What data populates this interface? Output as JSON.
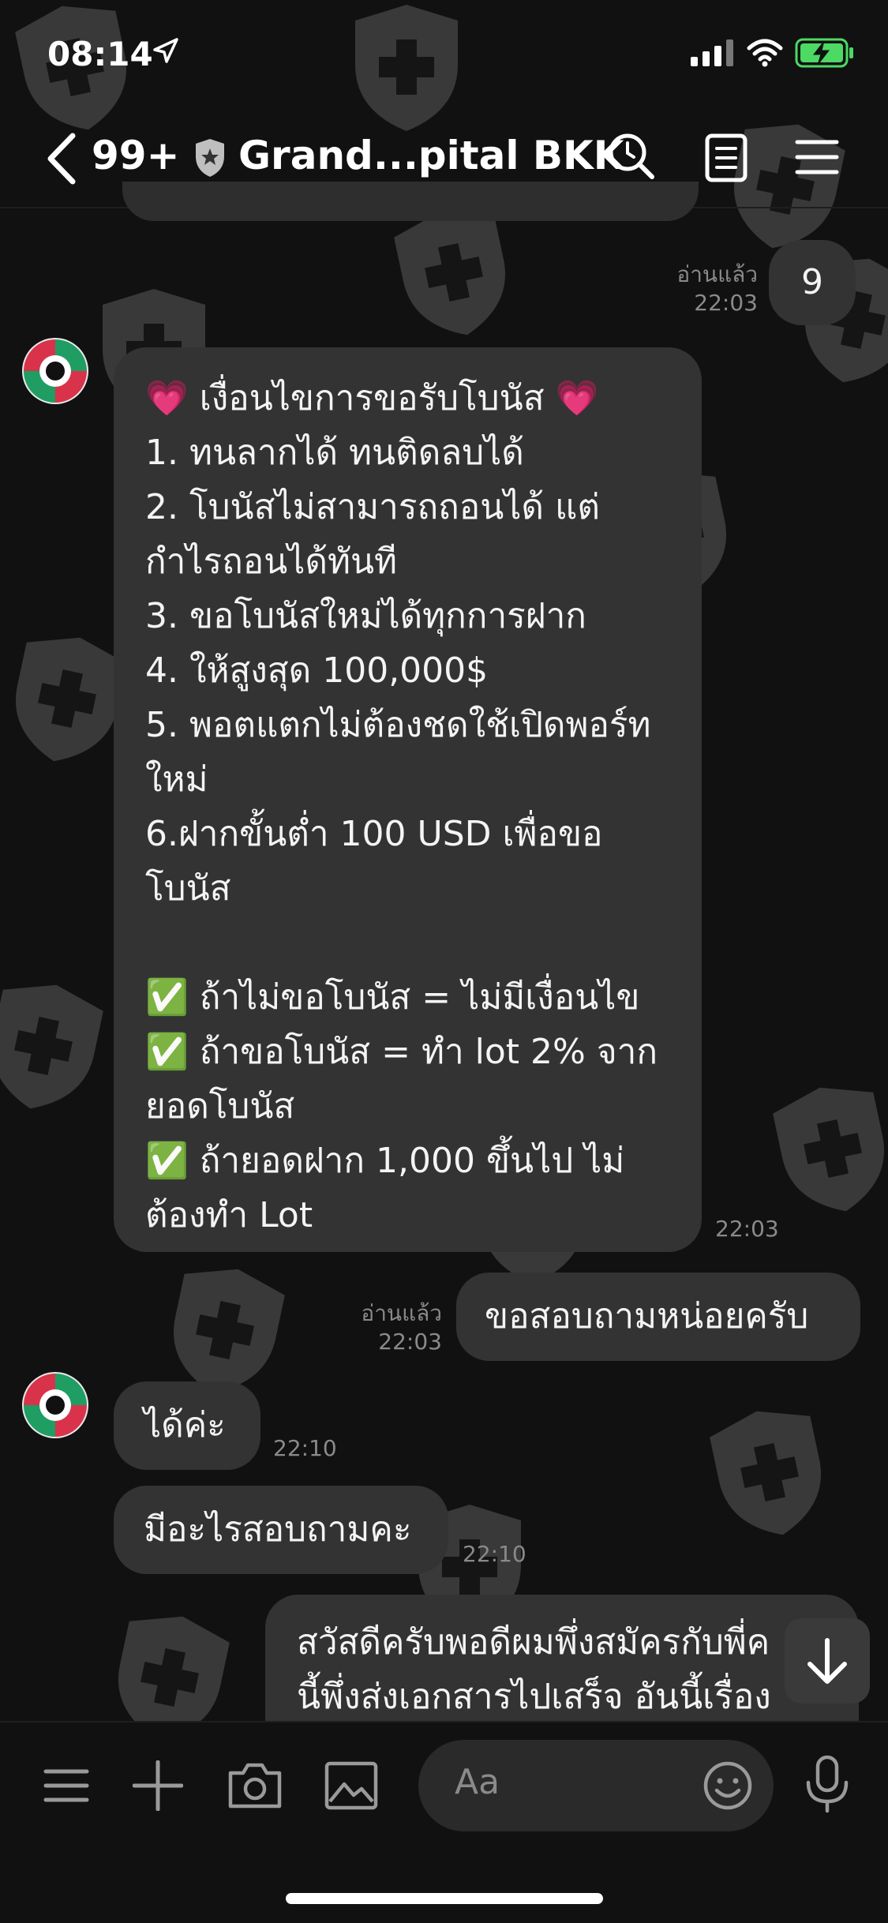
{
  "status_bar": {
    "time": "08:14",
    "icons": [
      "location-arrow-icon",
      "cellular-signal-icon",
      "wifi-icon",
      "battery-charging-icon"
    ]
  },
  "header": {
    "back_count": "99+",
    "title": "Grand...pital BKK",
    "icons": [
      "back-chevron-icon",
      "official-shield-icon",
      "search-icon",
      "notes-icon",
      "menu-icon"
    ]
  },
  "messages": [
    {
      "id": "out-9",
      "direction": "outgoing",
      "read_label": "อ่านแล้ว",
      "time": "22:03",
      "text": "9"
    },
    {
      "id": "in-conditions",
      "direction": "incoming",
      "time": "22:03",
      "text": "💗 เงื่อนไขการขอรับโบนัส 💗\n1. ทนลากได้ ทนติดลบได้\n2. โบนัสไม่สามารถถอนได้ แต่\nกำไรถอนได้ทันที\n3. ขอโบนัสใหม่ได้ทุกการฝาก\n4. ให้สูงสุด 100,000$\n5. พอตแตกไม่ต้องชดใช้เปิดพอร์ท\nใหม่\n6.ฝากขั้นต่ำ 100 USD เพื่อขอ\nโบนัส\n\n✅ ถ้าไม่ขอโบนัส = ไม่มีเงื่อนไข\n✅ ถ้าขอโบนัส = ทำ lot 2% จาก\nยอดโบนัส\n✅ ถ้ายอดฝาก 1,000 ขึ้นไป ไม่\nต้องทำ Lot"
    },
    {
      "id": "out-ask",
      "direction": "outgoing",
      "read_label": "อ่านแล้ว",
      "time": "22:03",
      "text": "ขอสอบถามหน่อยครับ"
    },
    {
      "id": "in-ok",
      "direction": "incoming",
      "time": "22:10",
      "text": "ได้ค่ะ"
    },
    {
      "id": "in-what",
      "direction": "incoming",
      "time": "22:10",
      "text": "มีอะไรสอบถามคะ"
    },
    {
      "id": "out-partial",
      "direction": "outgoing",
      "text": "สวัสดีครับพอดีผมพึ่งสมัครกับพี่ค\nนี้พึ่งส่งเอกสารไปเสร็จ อันนี้เรื่อง"
    }
  ],
  "input_bar": {
    "placeholder": "Aa",
    "icons": [
      "hamburger-menu-icon",
      "plus-icon",
      "camera-icon",
      "image-icon",
      "emoji-icon",
      "microphone-icon"
    ]
  },
  "scroll_button": {
    "icon": "arrow-down-icon"
  },
  "colors": {
    "background": "#111111",
    "bubble": "#333333",
    "text": "#f4f4f4",
    "meta": "#8a8a8a",
    "battery": "#4cd964"
  }
}
